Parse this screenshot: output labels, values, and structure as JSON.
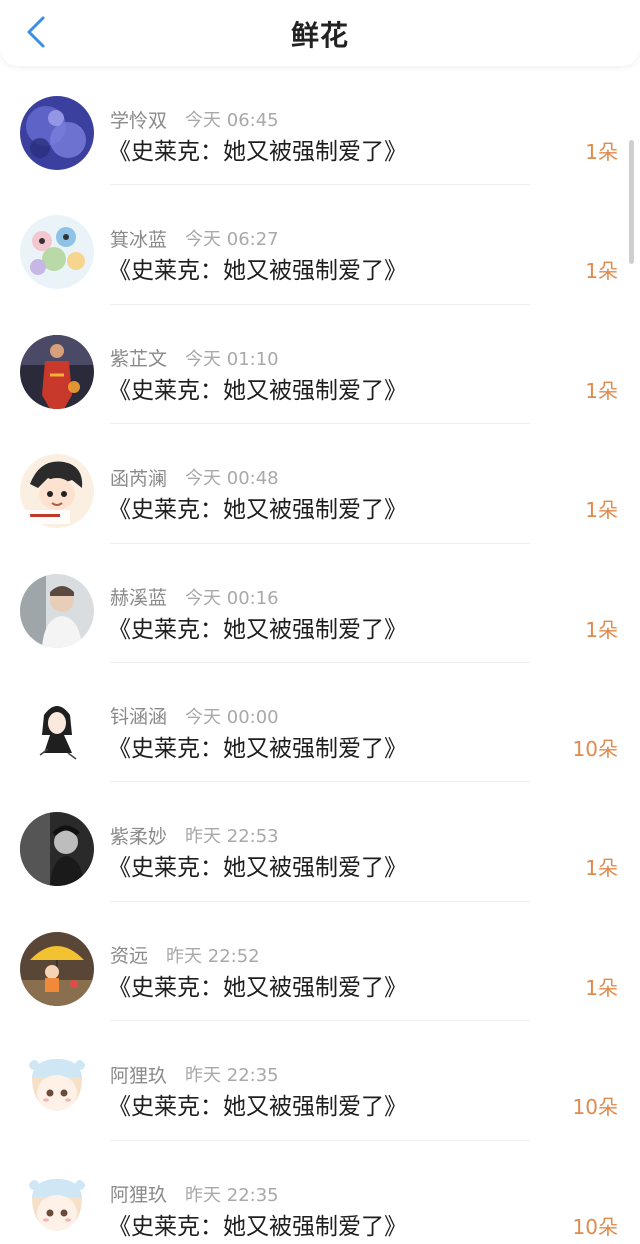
{
  "header": {
    "title": "鲜花"
  },
  "colors": {
    "accent": "#3a8ee6",
    "count": "#e08a4c"
  },
  "items": [
    {
      "avatar_icon": "purple-abstract-avatar",
      "user": "学怜双",
      "time": "今天 06:45",
      "book": "《史莱克：她又被强制爱了》",
      "count": "1朵"
    },
    {
      "avatar_icon": "cartoon-group-avatar",
      "user": "箕冰蓝",
      "time": "今天 06:27",
      "book": "《史莱克：她又被强制爱了》",
      "count": "1朵"
    },
    {
      "avatar_icon": "person-red-suit-avatar",
      "user": "紫芷文",
      "time": "今天 01:10",
      "book": "《史莱克：她又被强制爱了》",
      "count": "1朵"
    },
    {
      "avatar_icon": "anime-boy-avatar",
      "user": "函芮澜",
      "time": "今天 00:48",
      "book": "《史莱克：她又被强制爱了》",
      "count": "1朵"
    },
    {
      "avatar_icon": "person-photo-avatar",
      "user": "赫溪蓝",
      "time": "今天 00:16",
      "book": "《史莱克：她又被强制爱了》",
      "count": "1朵"
    },
    {
      "avatar_icon": "sketch-girl-avatar",
      "user": "钭涵涵",
      "time": "今天 00:00",
      "book": "《史莱克：她又被强制爱了》",
      "count": "10朵"
    },
    {
      "avatar_icon": "dark-photo-avatar",
      "user": "紫柔妙",
      "time": "昨天 22:53",
      "book": "《史莱克：她又被强制爱了》",
      "count": "1朵"
    },
    {
      "avatar_icon": "umbrella-child-avatar",
      "user": "资远",
      "time": "昨天 22:52",
      "book": "《史莱克：她又被强制爱了》",
      "count": "1朵"
    },
    {
      "avatar_icon": "chibi-girl-avatar",
      "user": "阿狸玖",
      "time": "昨天 22:35",
      "book": "《史莱克：她又被强制爱了》",
      "count": "10朵"
    },
    {
      "avatar_icon": "chibi-girl-avatar",
      "user": "阿狸玖",
      "time": "昨天 22:35",
      "book": "《史莱克：她又被强制爱了》",
      "count": "10朵"
    }
  ]
}
